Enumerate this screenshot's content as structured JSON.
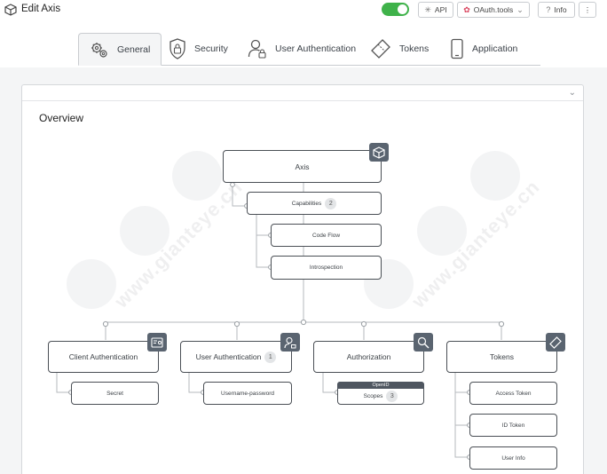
{
  "header": {
    "title": "Edit Axis",
    "buttons": {
      "api": "API",
      "oauth_tools": "OAuth.tools",
      "info": "Info",
      "more": "⋮"
    }
  },
  "tabs": [
    {
      "label": "General"
    },
    {
      "label": "Security"
    },
    {
      "label": "User Authentication"
    },
    {
      "label": "Tokens"
    },
    {
      "label": "Application"
    }
  ],
  "overview": {
    "title": "Overview"
  },
  "diagram": {
    "root": {
      "label": "Axis"
    },
    "capabilities": {
      "label": "Capabilities",
      "count": "2"
    },
    "code_flow": {
      "label": "Code Flow"
    },
    "introspection": {
      "label": "Introspection"
    },
    "client_auth": {
      "label": "Client Authentication"
    },
    "secret": {
      "label": "Secret"
    },
    "user_auth": {
      "label": "User Authentication",
      "count": "1"
    },
    "username_password": {
      "label": "Username-password"
    },
    "authorization": {
      "label": "Authorization"
    },
    "scopes": {
      "label": "Scopes",
      "count": "3",
      "tag": "OpenID"
    },
    "tokens": {
      "label": "Tokens"
    },
    "access_token": {
      "label": "Access Token"
    },
    "id_token": {
      "label": "ID Token"
    },
    "user_info": {
      "label": "User Info"
    }
  },
  "watermark": {
    "text": "www.gianteye.cn",
    "disc": "GIANTEYE"
  },
  "colors": {
    "toggle_on": "#3fb24a",
    "icon_tile": "#5a6470",
    "node_border": "#4a4f55",
    "oauth_dot": "#d9435e"
  }
}
